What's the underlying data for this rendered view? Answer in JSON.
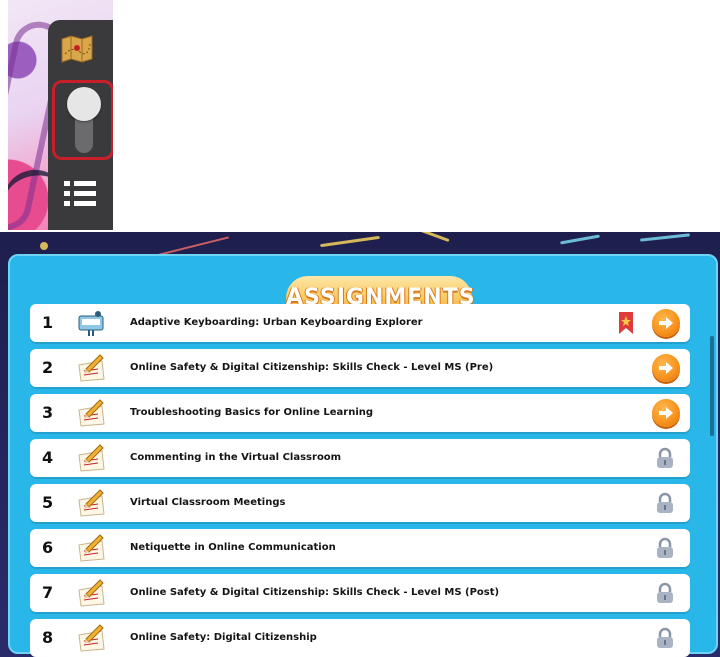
{
  "toolbar": {
    "icons": [
      "map-icon",
      "toggle-switch",
      "list-icon"
    ],
    "highlight_color": "#c8202a"
  },
  "panel": {
    "title": "ASSIGNMENTS",
    "accent": "#29b7e9",
    "action_color": "#f7931e"
  },
  "assignments": [
    {
      "number": "1",
      "title": "Adaptive Keyboarding: Urban Keyboarding Explorer",
      "icon": "keyboarding-icon",
      "status": "open",
      "bookmarked": true
    },
    {
      "number": "2",
      "title": "Online Safety & Digital Citizenship: Skills Check - Level MS (Pre)",
      "icon": "pencil-paper-icon",
      "status": "open"
    },
    {
      "number": "3",
      "title": "Troubleshooting Basics for Online Learning",
      "icon": "pencil-paper-icon",
      "status": "open"
    },
    {
      "number": "4",
      "title": "Commenting in the Virtual Classroom",
      "icon": "pencil-paper-icon",
      "status": "locked"
    },
    {
      "number": "5",
      "title": "Virtual Classroom Meetings",
      "icon": "pencil-paper-icon",
      "status": "locked"
    },
    {
      "number": "6",
      "title": "Netiquette in Online Communication",
      "icon": "pencil-paper-icon",
      "status": "locked"
    },
    {
      "number": "7",
      "title": "Online Safety & Digital Citizenship: Skills Check - Level MS (Post)",
      "icon": "pencil-paper-icon",
      "status": "locked"
    },
    {
      "number": "8",
      "title": "Online Safety: Digital Citizenship",
      "icon": "pencil-paper-icon",
      "status": "locked"
    }
  ]
}
